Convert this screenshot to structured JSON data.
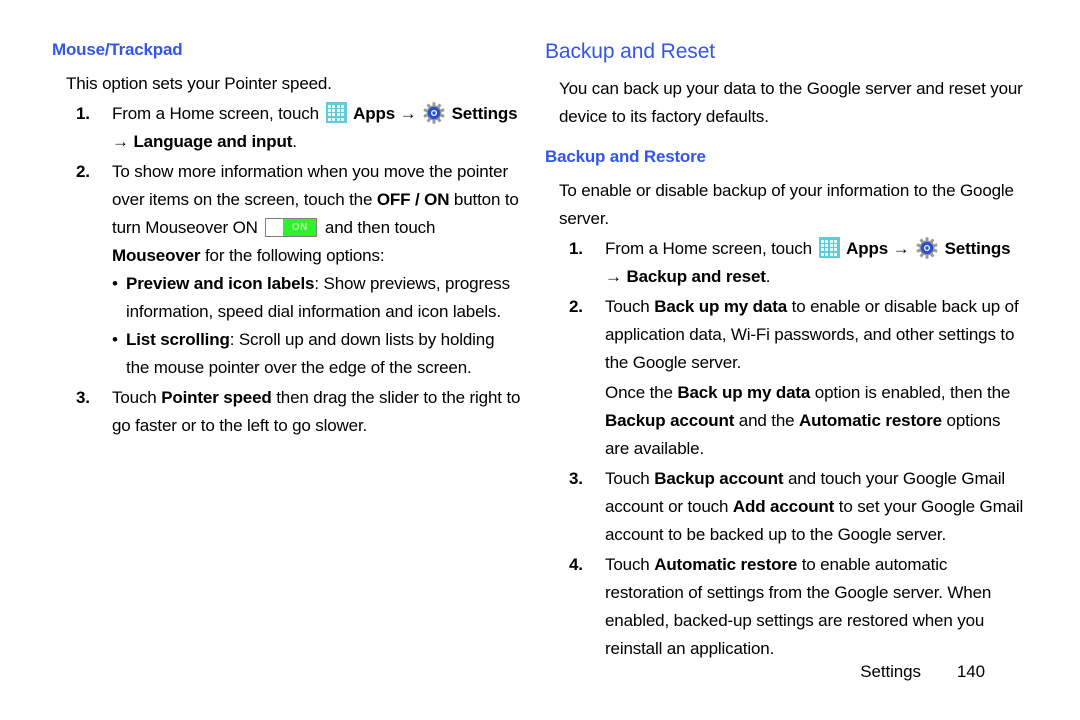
{
  "page": {
    "footer_section": "Settings",
    "footer_page_number": "140"
  },
  "colors": {
    "heading_blue": "#3355ee",
    "apps_icon_teal": "#63cbd8",
    "toggle_green": "#2ef22e",
    "toggle_on_text": "#b9f5a0",
    "gear_blue": "#2b4fd0",
    "body_black": "#000000"
  },
  "icons": {
    "apps": "apps-grid-icon",
    "settings": "settings-gear-icon",
    "arrow": "→",
    "bullet": "•",
    "toggle_on_label": "ON"
  },
  "left_column": {
    "heading": "Mouse/Trackpad",
    "intro": "This option sets your Pointer speed.",
    "steps": [
      {
        "num": "1.",
        "parts": [
          {
            "t": "From a Home screen, touch ",
            "s": "plain"
          },
          {
            "t": "apps-icon",
            "s": "icon-apps"
          },
          {
            "t": "Apps",
            "s": "bold"
          },
          {
            "t": "arrow",
            "s": "icon-arrow"
          },
          {
            "t": "settings-icon",
            "s": "icon-gear"
          },
          {
            "t": "Settings",
            "s": "bold"
          },
          {
            "t": "arrow-break",
            "s": "icon-arrow-newline"
          },
          {
            "t": "Language and input",
            "s": "bold"
          },
          {
            "t": ".",
            "s": "plain"
          }
        ]
      },
      {
        "num": "2.",
        "parts": [
          {
            "t": "To show more information when you move the pointer over items on the screen, touch the ",
            "s": "plain"
          },
          {
            "t": "OFF / ON",
            "s": "bold"
          },
          {
            "t": " button to turn Mouseover ON ",
            "s": "plain"
          },
          {
            "t": "toggle",
            "s": "toggle"
          },
          {
            "t": " and then touch ",
            "s": "plain"
          },
          {
            "t": "Mouseover",
            "s": "bold"
          },
          {
            "t": " for the following options:",
            "s": "plain"
          }
        ],
        "bullets": [
          {
            "label": "Preview and icon labels",
            "text": ": Show previews, progress information, speed dial information and icon labels."
          },
          {
            "label": "List scrolling",
            "text": ": Scroll up and down lists by holding the mouse pointer over the edge of the screen."
          }
        ]
      },
      {
        "num": "3.",
        "parts": [
          {
            "t": "Touch ",
            "s": "plain"
          },
          {
            "t": "Pointer speed",
            "s": "bold"
          },
          {
            "t": " then drag the slider to the right to go faster or to the left to go slower.",
            "s": "plain"
          }
        ]
      }
    ]
  },
  "right_column": {
    "heading": "Backup and Reset",
    "intro": "You can back up your data to the Google server and reset your device to its factory defaults.",
    "subheading": "Backup and Restore",
    "subintro": "To enable or disable backup of your information to the Google server.",
    "steps": [
      {
        "num": "1.",
        "parts": [
          {
            "t": "From a Home screen, touch ",
            "s": "plain"
          },
          {
            "t": "apps-icon",
            "s": "icon-apps"
          },
          {
            "t": "Apps",
            "s": "bold"
          },
          {
            "t": "arrow",
            "s": "icon-arrow"
          },
          {
            "t": "settings-icon",
            "s": "icon-gear"
          },
          {
            "t": "Settings",
            "s": "bold"
          },
          {
            "t": "arrow-break",
            "s": "icon-arrow-newline"
          },
          {
            "t": "Backup and reset",
            "s": "bold"
          },
          {
            "t": ".",
            "s": "plain"
          }
        ]
      },
      {
        "num": "2.",
        "parts": [
          {
            "t": "Touch ",
            "s": "plain"
          },
          {
            "t": "Back up my data",
            "s": "bold"
          },
          {
            "t": " to enable or disable back up of application data, Wi-Fi passwords, and other settings to the Google server.",
            "s": "plain"
          }
        ],
        "continuation": [
          {
            "t": "Once the ",
            "s": "plain"
          },
          {
            "t": "Back up my data",
            "s": "bold"
          },
          {
            "t": " option is enabled, then the ",
            "s": "plain"
          },
          {
            "t": "Backup account",
            "s": "bold"
          },
          {
            "t": " and the ",
            "s": "plain"
          },
          {
            "t": "Automatic restore",
            "s": "bold"
          },
          {
            "t": " options are available.",
            "s": "plain"
          }
        ]
      },
      {
        "num": "3.",
        "parts": [
          {
            "t": "Touch ",
            "s": "plain"
          },
          {
            "t": "Backup account",
            "s": "bold"
          },
          {
            "t": " and touch your Google Gmail account or touch ",
            "s": "plain"
          },
          {
            "t": "Add account",
            "s": "bold"
          },
          {
            "t": " to set your Google Gmail account to be backed up to the Google server.",
            "s": "plain"
          }
        ]
      },
      {
        "num": "4.",
        "parts": [
          {
            "t": "Touch ",
            "s": "plain"
          },
          {
            "t": "Automatic restore",
            "s": "bold"
          },
          {
            "t": " to enable automatic restoration of settings from the Google server. When enabled, backed-up settings are restored when you reinstall an application.",
            "s": "plain"
          }
        ]
      }
    ]
  }
}
